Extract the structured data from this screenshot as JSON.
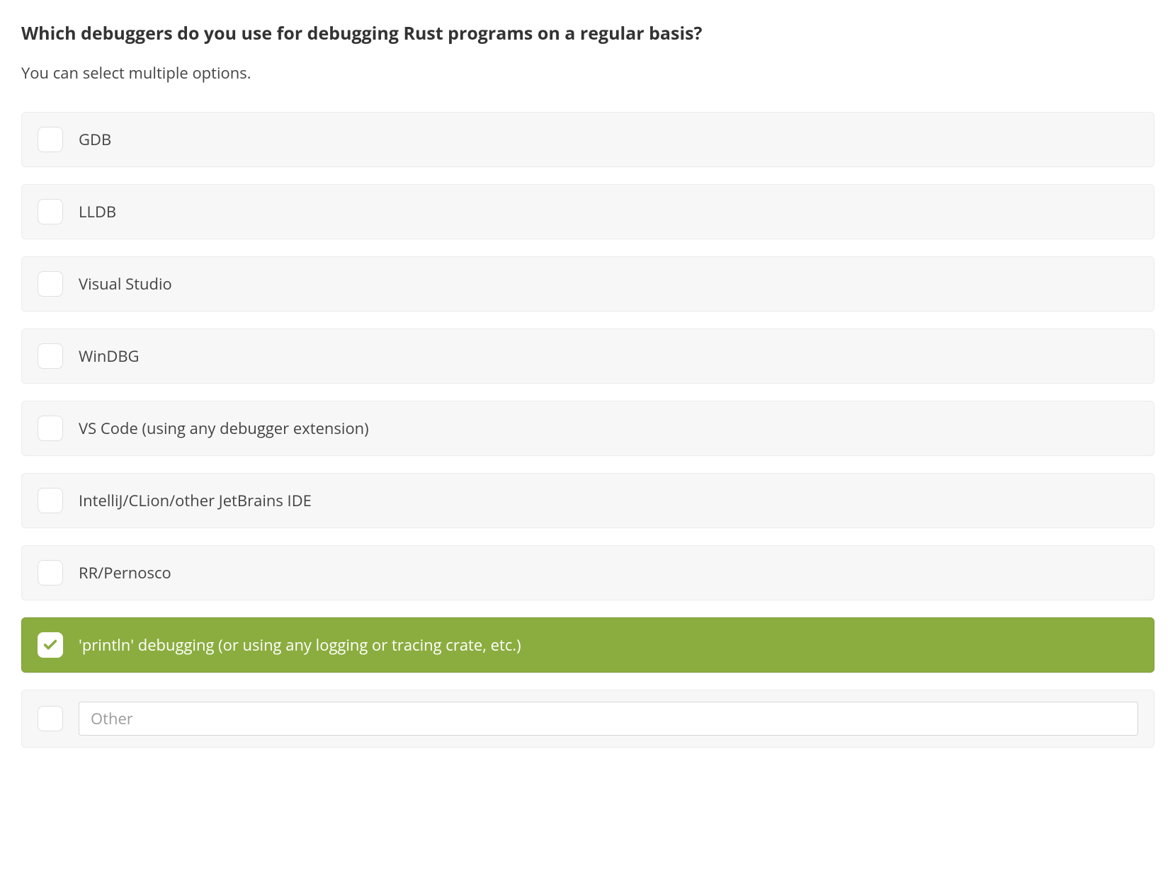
{
  "question": {
    "title": "Which debuggers do you use for debugging Rust programs on a regular basis?",
    "subtitle": "You can select multiple options."
  },
  "options": [
    {
      "label": "GDB",
      "checked": false
    },
    {
      "label": "LLDB",
      "checked": false
    },
    {
      "label": "Visual Studio",
      "checked": false
    },
    {
      "label": "WinDBG",
      "checked": false
    },
    {
      "label": "VS Code (using any debugger extension)",
      "checked": false
    },
    {
      "label": "IntelliJ/CLion/other JetBrains IDE",
      "checked": false
    },
    {
      "label": "RR/Pernosco",
      "checked": false
    },
    {
      "label": "'println' debugging (or using any logging or tracing crate, etc.)",
      "checked": true
    }
  ],
  "other": {
    "placeholder": "Other",
    "checked": false,
    "value": ""
  }
}
